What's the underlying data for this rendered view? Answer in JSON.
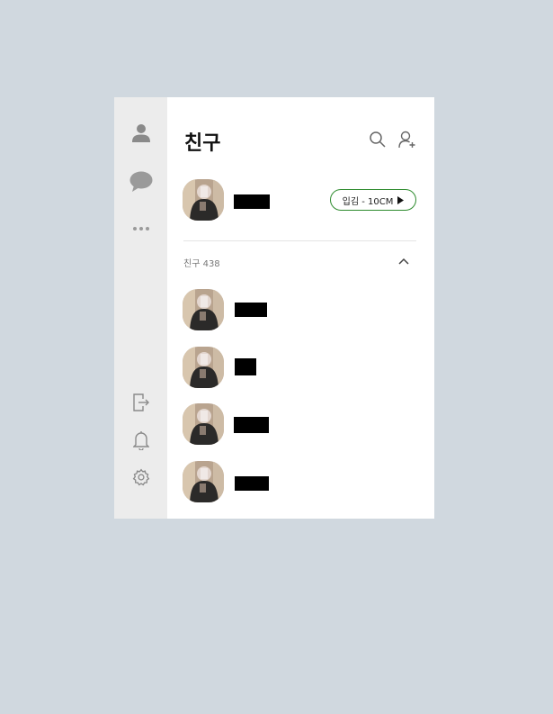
{
  "header": {
    "title": "친구",
    "search_icon": "search-icon",
    "add_friend_icon": "add-friend-icon"
  },
  "sidebar": {
    "top_items": [
      {
        "icon": "person-icon",
        "label": "friends"
      },
      {
        "icon": "chat-bubble-icon",
        "label": "chats"
      },
      {
        "icon": "more-dots-icon",
        "label": "more"
      }
    ],
    "bottom_items": [
      {
        "icon": "logout-icon"
      },
      {
        "icon": "bell-icon"
      },
      {
        "icon": "gear-icon"
      }
    ]
  },
  "my_profile": {
    "music_label": "입김 - 10CM",
    "play_icon": "play-icon"
  },
  "friends_section": {
    "label": "친구 438",
    "collapse_icon": "chevron-up-icon"
  },
  "colors": {
    "background": "#d0d8df",
    "sidebar": "#ececec",
    "icon": "#8a8a8a",
    "music_border": "#2e8b2e"
  }
}
